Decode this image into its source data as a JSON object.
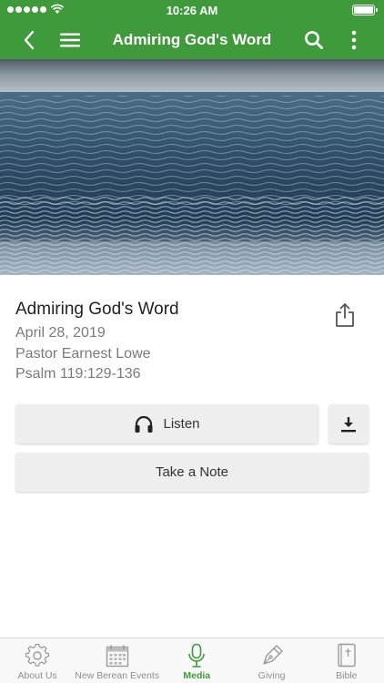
{
  "status_bar": {
    "time": "10:26 AM"
  },
  "nav": {
    "title": "Admiring God's Word",
    "back_icon": "chevron-left-icon",
    "menu_icon": "hamburger-menu-icon",
    "search_icon": "search-icon",
    "more_icon": "more-vertical-icon"
  },
  "sermon": {
    "title": "Admiring God's Word",
    "date": "April 28, 2019",
    "speaker": "Pastor Earnest Lowe",
    "passage": "Psalm 119:129-136"
  },
  "actions": {
    "listen_label": "Listen",
    "note_label": "Take a Note"
  },
  "tabs": [
    {
      "label": "About Us",
      "icon": "gear-icon"
    },
    {
      "label": "New Berean Events",
      "icon": "calendar-icon"
    },
    {
      "label": "Media",
      "icon": "microphone-icon",
      "active": true
    },
    {
      "label": "Giving",
      "icon": "pen-nib-icon"
    },
    {
      "label": "Bible",
      "icon": "bible-book-icon"
    }
  ],
  "colors": {
    "brand_green": "#3f9a3c",
    "button_bg": "#eeeeef",
    "muted_text": "#7a7a7a"
  }
}
